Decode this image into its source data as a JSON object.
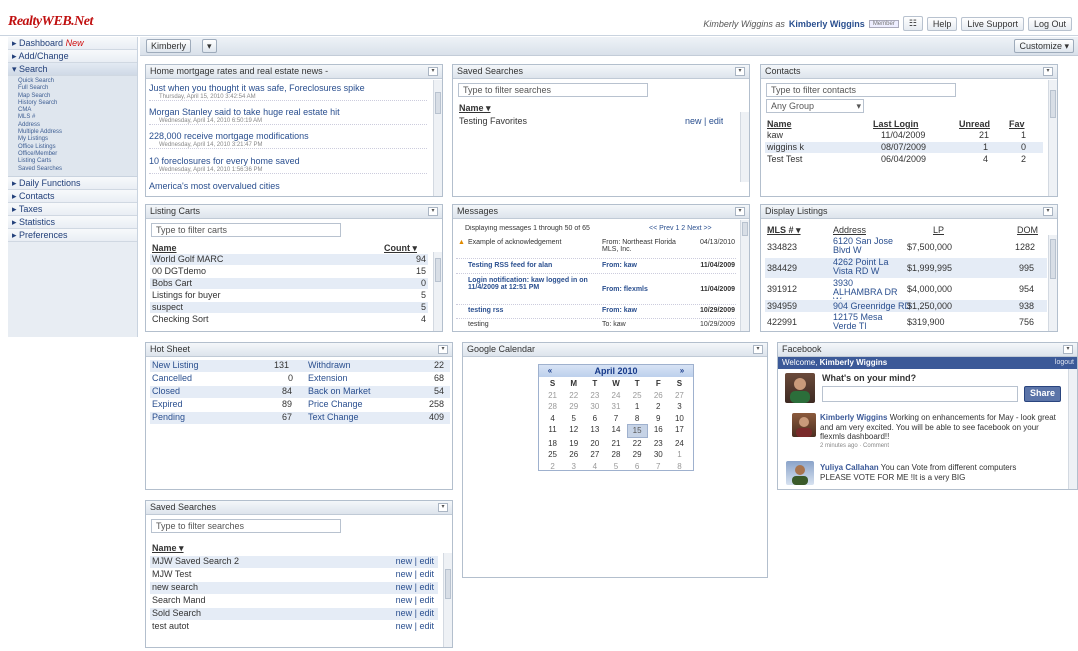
{
  "app": {
    "logo": "RealtyWEB.Net",
    "user_prefix": "Kimberly Wiggins as",
    "user_name": "Kimberly Wiggins",
    "user_badge": "Member",
    "top_buttons": [
      "Help",
      "Live Support",
      "Log Out"
    ]
  },
  "sidebar": {
    "items": [
      {
        "label": "Dashboard",
        "badge": "New"
      },
      {
        "label": "Add/Change"
      },
      {
        "label": "Search"
      },
      {
        "label": "Daily Functions"
      },
      {
        "label": "Contacts"
      },
      {
        "label": "Taxes"
      },
      {
        "label": "Statistics"
      },
      {
        "label": "Preferences"
      }
    ],
    "search_sub": [
      "Quick Search",
      "Full Search",
      "Map Search",
      "History Search",
      "CMA",
      "MLS #",
      "Address",
      "Multiple Address",
      "My Listings",
      "Office Listings",
      "Office/Member",
      "Listing Carts",
      "Saved Searches"
    ]
  },
  "toolbar": {
    "user_select": "Kimberly",
    "customize": "Customize"
  },
  "news": {
    "title": "Home mortgage rates and real estate news -",
    "items": [
      {
        "title": "Just when you thought it was safe, Foreclosures spike",
        "date": "Thursday, April 15, 2010 3:42:54 AM"
      },
      {
        "title": "Morgan Stanley said to take huge real estate hit",
        "date": "Wednesday, April 14, 2010 6:50:19 AM"
      },
      {
        "title": "228,000 receive mortgage modifications",
        "date": "Wednesday, April 14, 2010 3:21:47 PM"
      },
      {
        "title": "10 foreclosures for every home saved",
        "date": "Wednesday, April 14, 2010 1:56:36 PM"
      },
      {
        "title": "America's most overvalued cities",
        "date": ""
      }
    ]
  },
  "saved_top": {
    "title": "Saved Searches",
    "filter": "Type to filter searches",
    "col_name": "Name",
    "rows": [
      {
        "name": "Testing Favorites",
        "actions": "new | edit"
      }
    ]
  },
  "contacts": {
    "title": "Contacts",
    "filter": "Type to filter contacts",
    "group": "Any Group",
    "cols": [
      "Name",
      "Last Login",
      "Unread",
      "Fav"
    ],
    "rows": [
      {
        "name": "kaw",
        "login": "11/04/2009",
        "unread": "21",
        "fav": "1"
      },
      {
        "name": "wiggins k",
        "login": "08/07/2009",
        "unread": "1",
        "fav": "0"
      },
      {
        "name": "Test Test",
        "login": "06/04/2009",
        "unread": "4",
        "fav": "2"
      }
    ]
  },
  "carts": {
    "title": "Listing Carts",
    "filter": "Type to filter carts",
    "col_name": "Name",
    "col_count": "Count",
    "rows": [
      {
        "name": "World Golf MARC",
        "count": "94"
      },
      {
        "name": "00 DGTdemo",
        "count": "15"
      },
      {
        "name": "Bobs Cart",
        "count": "0"
      },
      {
        "name": "Listings for buyer",
        "count": "5"
      },
      {
        "name": "suspect",
        "count": "5"
      },
      {
        "name": "Checking Sort",
        "count": "4"
      }
    ]
  },
  "messages": {
    "title": "Messages",
    "summary": "Displaying messages 1 through 50 of 65",
    "pager": "<< Prev 1 2 Next >>",
    "rows": [
      {
        "subject": "Example of acknowledgement",
        "from": "From: Northeast Florida MLS, Inc.",
        "date": "04/13/2010"
      },
      {
        "subject": "Testing RSS feed for alan",
        "from": "From: kaw",
        "date": "11/04/2009"
      },
      {
        "subject": "Login notification: kaw logged in on 11/4/2009 at 12:51 PM",
        "from": "From: flexmls",
        "date": "11/04/2009"
      },
      {
        "subject": "testing rss",
        "from": "From: kaw",
        "date": "10/29/2009"
      },
      {
        "subject": "testing",
        "from": "To: kaw",
        "date": "10/29/2009"
      }
    ]
  },
  "display_listings": {
    "title": "Display Listings",
    "cols": [
      "MLS #",
      "Address",
      "LP",
      "DOM"
    ],
    "rows": [
      {
        "mls": "334823",
        "address": "6120 San Jose Blvd W",
        "lp": "$7,500,000",
        "dom": "1282"
      },
      {
        "mls": "384429",
        "address": "4262 Point La Vista RD W",
        "lp": "$1,999,995",
        "dom": "995"
      },
      {
        "mls": "391912",
        "address": "3930 ALHAMBRA DR W",
        "lp": "$4,000,000",
        "dom": "954"
      },
      {
        "mls": "394959",
        "address": "904 Greenridge RD",
        "lp": "$1,250,000",
        "dom": "938"
      },
      {
        "mls": "422991",
        "address": "12175 Mesa Verde Tl",
        "lp": "$319,900",
        "dom": "756"
      }
    ]
  },
  "hotsheet": {
    "title": "Hot Sheet",
    "left": [
      {
        "label": "New Listing",
        "value": "131"
      },
      {
        "label": "Cancelled",
        "value": "0"
      },
      {
        "label": "Closed",
        "value": "84"
      },
      {
        "label": "Expired",
        "value": "89"
      },
      {
        "label": "Pending",
        "value": "67"
      }
    ],
    "right": [
      {
        "label": "Withdrawn",
        "value": "22"
      },
      {
        "label": "Extension",
        "value": "68"
      },
      {
        "label": "Back on Market",
        "value": "54"
      },
      {
        "label": "Price Change",
        "value": "258"
      },
      {
        "label": "Text Change",
        "value": "409"
      }
    ]
  },
  "calendar": {
    "title": "Google Calendar",
    "month": "April 2010",
    "prev": "«",
    "next": "»",
    "dow": [
      "S",
      "M",
      "T",
      "W",
      "T",
      "F",
      "S"
    ],
    "weeks": [
      [
        "21",
        "22",
        "23",
        "24",
        "25",
        "26",
        "27"
      ],
      [
        "28",
        "29",
        "30",
        "31",
        "1",
        "2",
        "3"
      ],
      [
        "4",
        "5",
        "6",
        "7",
        "8",
        "9",
        "10"
      ],
      [
        "11",
        "12",
        "13",
        "14",
        "15",
        "16",
        "17"
      ],
      [
        "18",
        "19",
        "20",
        "21",
        "22",
        "23",
        "24"
      ],
      [
        "25",
        "26",
        "27",
        "28",
        "29",
        "30",
        "1"
      ],
      [
        "2",
        "3",
        "4",
        "5",
        "6",
        "7",
        "8"
      ]
    ],
    "today": "15"
  },
  "facebook": {
    "title": "Facebook",
    "welcome": "Welcome,",
    "welcome_name": "Kimberly Wiggins",
    "logout": "logout",
    "prompt": "What's on your mind?",
    "share": "Share",
    "posts": [
      {
        "name": "Kimberly Wiggins",
        "text": "Working on enhancements for May - look great and am very excited. You will be able to see facebook on your flexmls dashboard!!",
        "meta": "2 minutes ago · Comment"
      },
      {
        "name": "Yuliya Callahan",
        "text": "You can Vote from different computers PLEASE VOTE FOR ME !It is a very BIG",
        "meta": ""
      }
    ]
  },
  "saved_bottom": {
    "title": "Saved Searches",
    "filter": "Type to filter searches",
    "col_name": "Name",
    "rows": [
      {
        "name": "MJW Saved Search 2",
        "actions": "new | edit"
      },
      {
        "name": "MJW Test",
        "actions": "new | edit"
      },
      {
        "name": "new search",
        "actions": "new | edit"
      },
      {
        "name": "Search Mand",
        "actions": "new | edit"
      },
      {
        "name": "Sold Search",
        "actions": "new | edit"
      },
      {
        "name": "test autot",
        "actions": "new | edit"
      }
    ]
  }
}
